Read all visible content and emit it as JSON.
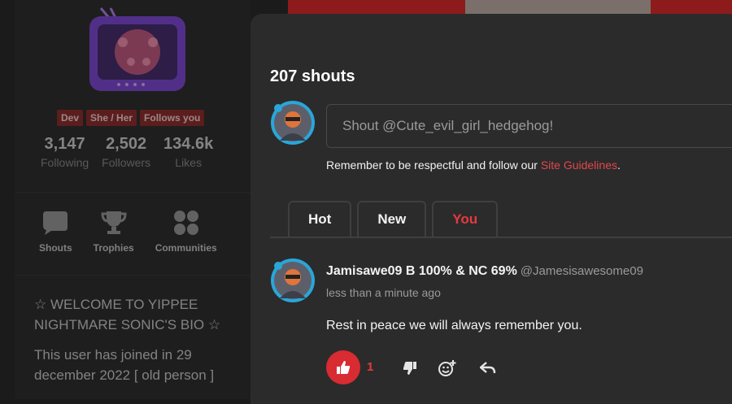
{
  "profile": {
    "badges": [
      "Dev",
      "She / Her",
      "Follows you"
    ],
    "stats": [
      {
        "value": "3,147",
        "label": "Following"
      },
      {
        "value": "2,502",
        "label": "Followers"
      },
      {
        "value": "134.6k",
        "label": "Likes"
      }
    ],
    "nav": [
      {
        "icon": "speech-bubble-icon",
        "label": "Shouts"
      },
      {
        "icon": "trophy-icon",
        "label": "Trophies"
      },
      {
        "icon": "communities-icon",
        "label": "Communities"
      }
    ],
    "bio": [
      "☆ WELCOME TO YIPPEE NIGHTMARE SONIC'S BIO ☆",
      "This user has joined in 29 december 2022 [ old person ]"
    ]
  },
  "shouts": {
    "title": "207 shouts",
    "input_placeholder": "Shout @Cute_evil_girl_hedgehog!",
    "guidelines_text": "Remember to be respectful and follow our ",
    "guidelines_link": "Site Guidelines",
    "guidelines_end": ".",
    "tabs": [
      {
        "label": "Hot",
        "active": false
      },
      {
        "label": "New",
        "active": false
      },
      {
        "label": "You",
        "active": true
      }
    ],
    "post": {
      "author": "Jamisawe09 B 100% & NC 69%",
      "handle": "@Jamesisawesome09",
      "time": "less than a minute ago",
      "text": "Rest in peace we will always remember you.",
      "likes": "1"
    }
  },
  "colors": {
    "accent": "#e53a3f",
    "like_button": "#d82b32",
    "badge": "#8f1d1d",
    "panel": "#2b2b2b",
    "background": "#1b1b1b"
  }
}
